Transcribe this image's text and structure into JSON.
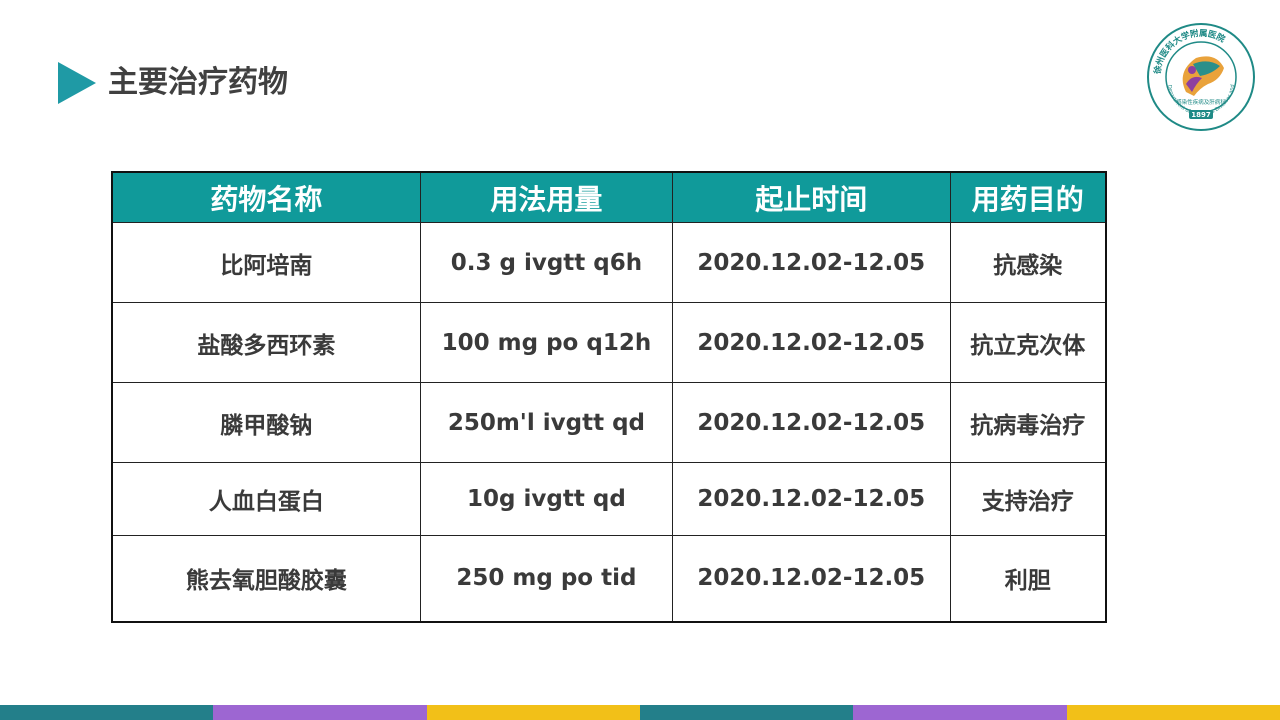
{
  "slide": {
    "title": "主要治疗药物"
  },
  "logo": {
    "top_text": "徐州医科大学附属医院",
    "ring_text": "Department of Infectious Diseases and Liver Diseases",
    "inner_text": "感染性疾病及肝病科",
    "year": "1897"
  },
  "table": {
    "headers": [
      "药物名称",
      "用法用量",
      "起止时间",
      "用药目的"
    ],
    "rows": [
      [
        "比阿培南",
        "0.3 g ivgtt q6h",
        "2020.12.02-12.05",
        "抗感染"
      ],
      [
        "盐酸多西环素",
        "100 mg po q12h",
        "2020.12.02-12.05",
        "抗立克次体"
      ],
      [
        "膦甲酸钠",
        "250m'l ivgtt qd",
        "2020.12.02-12.05",
        "抗病毒治疗"
      ],
      [
        "人血白蛋白",
        "10g ivgtt qd",
        "2020.12.02-12.05",
        "支持治疗"
      ],
      [
        "熊去氧胆酸胶囊",
        "250 mg po tid",
        "2020.12.02-12.05",
        "利胆"
      ]
    ]
  },
  "colors": {
    "accent_teal": "#1f9aa5",
    "header_bg": "#109a9a",
    "bar": [
      "#237f8a",
      "#9d66d2",
      "#f2c018",
      "#237f8a",
      "#9d66d2",
      "#f2c018"
    ]
  }
}
